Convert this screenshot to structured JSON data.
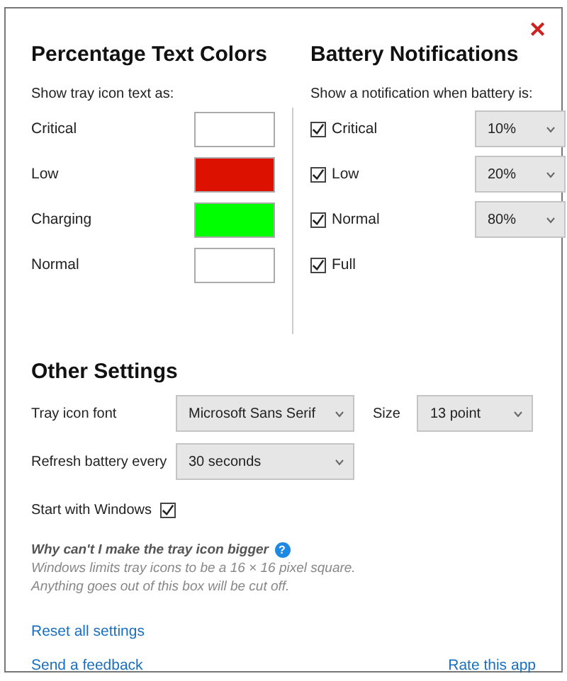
{
  "close": "✕",
  "text_colors": {
    "title": "Percentage Text Colors",
    "caption": "Show tray icon text as:",
    "rows": [
      {
        "label": "Critical",
        "color": "#ffffff"
      },
      {
        "label": "Low",
        "color": "#dd1100"
      },
      {
        "label": "Charging",
        "color": "#00ff00"
      },
      {
        "label": "Normal",
        "color": "#ffffff"
      }
    ]
  },
  "notifications": {
    "title": "Battery Notifications",
    "caption": "Show a notification when battery is:",
    "rows": [
      {
        "label": "Critical",
        "checked": true,
        "value": "10%"
      },
      {
        "label": "Low",
        "checked": true,
        "value": "20%"
      },
      {
        "label": "Normal",
        "checked": true,
        "value": "80%"
      },
      {
        "label": "Full",
        "checked": true
      }
    ]
  },
  "other": {
    "title": "Other Settings",
    "font": {
      "label": "Tray icon font",
      "value": "Microsoft Sans Serif"
    },
    "size": {
      "label": "Size",
      "value": "13 point"
    },
    "refresh": {
      "label": "Refresh battery every",
      "value": "30 seconds"
    },
    "startup": {
      "label": "Start with Windows",
      "checked": true
    }
  },
  "help": {
    "question": "Why can't I make the tray icon bigger",
    "icon": "?",
    "lines": [
      "Windows limits tray icons to be a 16 × 16 pixel square.",
      "Anything goes out of this box will be cut off."
    ]
  },
  "links": {
    "reset": "Reset all settings",
    "feedback": "Send a feedback",
    "rate": "Rate this app"
  }
}
